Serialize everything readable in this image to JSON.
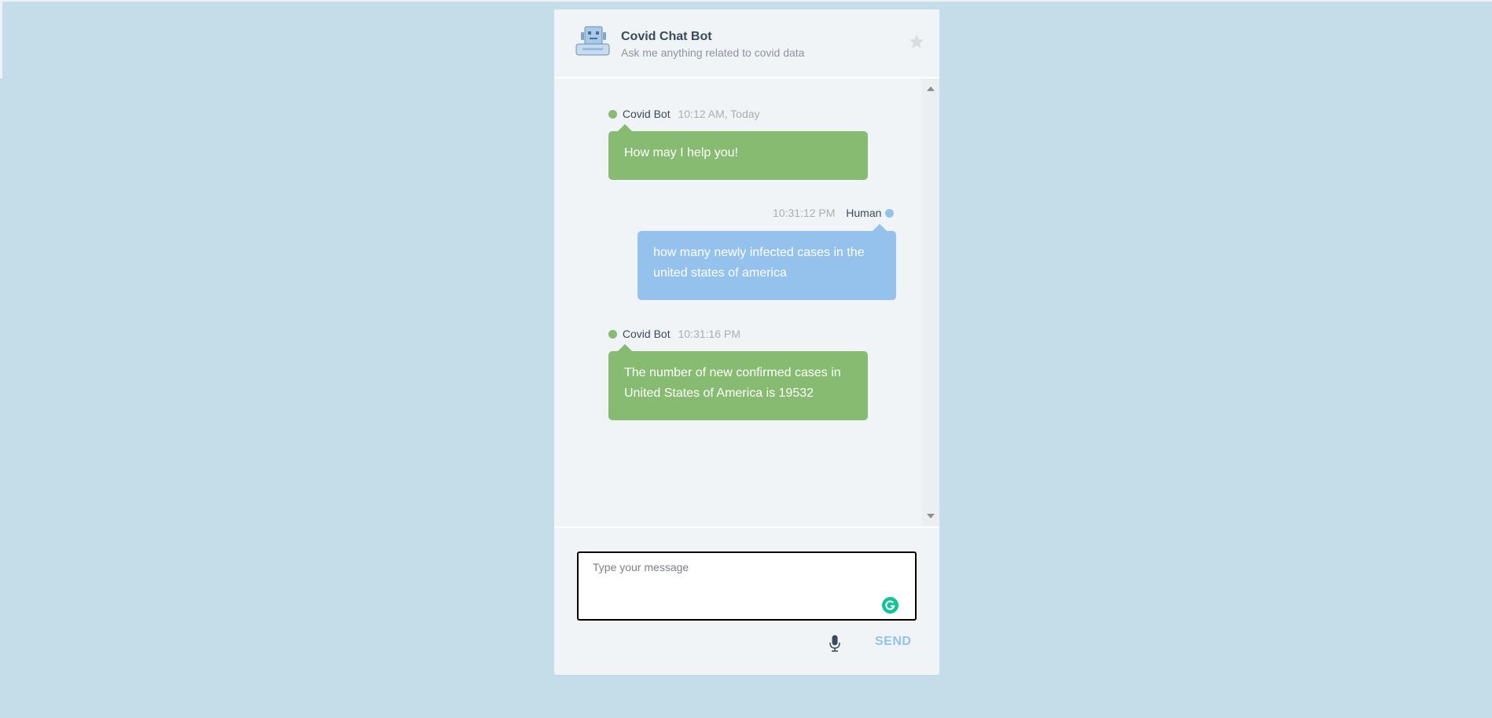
{
  "header": {
    "title": "Covid Chat Bot",
    "subtitle": "Ask me anything related to covid data",
    "avatar_icon": "robot-icon",
    "favorite_icon": "star-icon"
  },
  "messages": [
    {
      "sender": "Covid Bot",
      "time": "10:12 AM, Today",
      "text": "How may I help you!",
      "role": "bot"
    },
    {
      "sender": "Human",
      "time": "10:31:12 PM",
      "text": "how many newly infected cases in the united states of america",
      "role": "human"
    },
    {
      "sender": "Covid Bot",
      "time": "10:31:16 PM",
      "text": "The number of new confirmed cases in United States of America is 19532",
      "role": "bot"
    }
  ],
  "composer": {
    "placeholder": "Type your message",
    "value": "",
    "send_label": "SEND",
    "mic_icon": "microphone-icon",
    "grammarly_icon": "grammarly-icon"
  },
  "colors": {
    "page_background": "#c5dde9",
    "panel_background": "#f1f4f7",
    "bot_bubble": "#86bb71",
    "human_bubble": "#94c2ed",
    "send_text": "#94c2ed",
    "grammarly": "#15c39a"
  }
}
